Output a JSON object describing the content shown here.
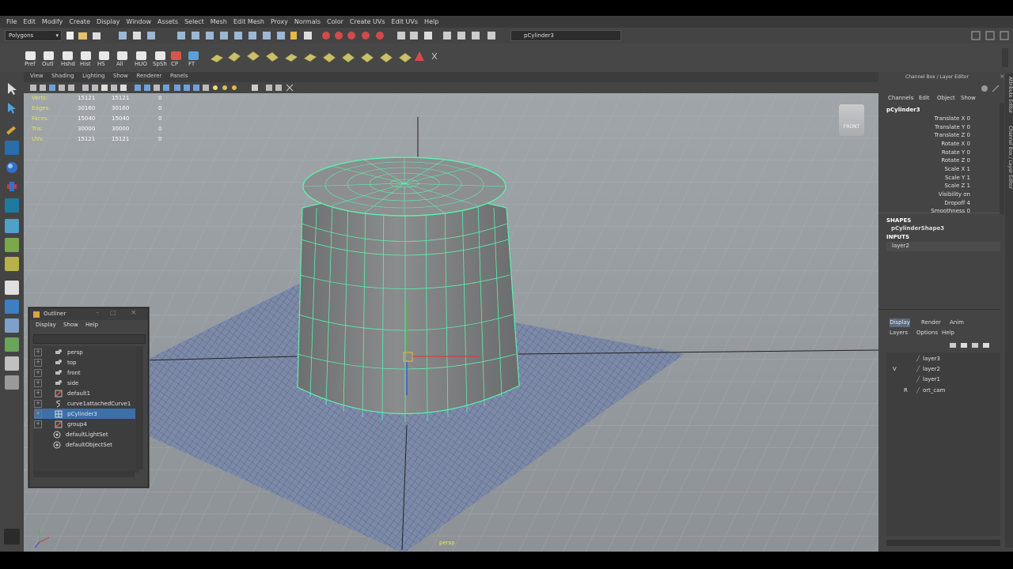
{
  "menubar": {
    "items": [
      "File",
      "Edit",
      "Modify",
      "Create",
      "Display",
      "Window",
      "Assets",
      "Select",
      "Mesh",
      "Edit Mesh",
      "Proxy",
      "Normals",
      "Color",
      "Create UVs",
      "Edit UVs",
      "Help"
    ]
  },
  "status": {
    "mode": "Polygons",
    "object_field": "pCylinder3"
  },
  "shelf": {
    "labels": [
      "Pref",
      "Outl",
      "Hshd",
      "Hist",
      "HS",
      "SpSh",
      "CP",
      "FT",
      "All",
      "HUO"
    ]
  },
  "viewport": {
    "menu": [
      "View",
      "Shading",
      "Lighting",
      "Show",
      "Renderer",
      "Panels"
    ],
    "hud": [
      {
        "label": "Verts:",
        "a": "15121",
        "b": "15121",
        "c": "0"
      },
      {
        "label": "Edges:",
        "a": "30160",
        "b": "30160",
        "c": "0"
      },
      {
        "label": "Faces:",
        "a": "15040",
        "b": "15040",
        "c": "0"
      },
      {
        "label": "Tris:",
        "a": "30000",
        "b": "30000",
        "c": "0"
      },
      {
        "label": "UVs:",
        "a": "15121",
        "b": "15121",
        "c": "0"
      }
    ],
    "camera_label": "persp",
    "viewcube_label": "FRONT"
  },
  "outliner": {
    "title": "Outliner",
    "menu": [
      "Display",
      "Show",
      "Help"
    ],
    "items": [
      {
        "label": "persp",
        "selected": false
      },
      {
        "label": "top",
        "selected": false
      },
      {
        "label": "front",
        "selected": false
      },
      {
        "label": "side",
        "selected": false
      },
      {
        "label": "default1",
        "selected": false
      },
      {
        "label": "curve1attachedCurve1",
        "selected": false
      },
      {
        "label": "pCylinder3",
        "selected": true
      },
      {
        "label": "group4",
        "selected": false
      },
      {
        "label": "defaultLightSet",
        "selected": false
      },
      {
        "label": "defaultObjectSet",
        "selected": false
      }
    ]
  },
  "channelbox": {
    "title": "Channel Box / Layer Editor",
    "menu": [
      "Channels",
      "Edit",
      "Object",
      "Show"
    ],
    "object": "pCylinder3",
    "attributes": [
      {
        "name": "Translate X",
        "value": "0"
      },
      {
        "name": "Translate Y",
        "value": "0"
      },
      {
        "name": "Translate Z",
        "value": "0"
      },
      {
        "name": "Rotate X",
        "value": "0"
      },
      {
        "name": "Rotate Y",
        "value": "0"
      },
      {
        "name": "Rotate Z",
        "value": "0"
      },
      {
        "name": "Scale X",
        "value": "1"
      },
      {
        "name": "Scale Y",
        "value": "1"
      },
      {
        "name": "Scale Z",
        "value": "1"
      },
      {
        "name": "Visibility",
        "value": "on"
      },
      {
        "name": "Dropoff",
        "value": "4"
      },
      {
        "name": "Smoothness",
        "value": "0"
      }
    ],
    "shapes_header": "SHAPES",
    "shape_name": "pCylinderShape3",
    "inputs_header": "INPUTS",
    "input_name": "layer2"
  },
  "layer_editor": {
    "tabs": [
      "Display",
      "Render",
      "Anim"
    ],
    "menu": [
      "Layers",
      "Options",
      "Help"
    ],
    "layers": [
      {
        "flag": "",
        "name": "layer3"
      },
      {
        "flag": "V",
        "name": "layer2"
      },
      {
        "flag": "",
        "name": "layer1"
      },
      {
        "flag": "R",
        "name": "ort_cam"
      }
    ]
  },
  "side_tabs": {
    "attribute_editor": "Attribute Editor",
    "channel_box": "Channel Box / Layer Editor"
  },
  "colors": {
    "wire": "#5ff0b0",
    "viewport_bg": "#9aa0a4",
    "panel": "#444444",
    "selection": "#3d6fa8"
  }
}
